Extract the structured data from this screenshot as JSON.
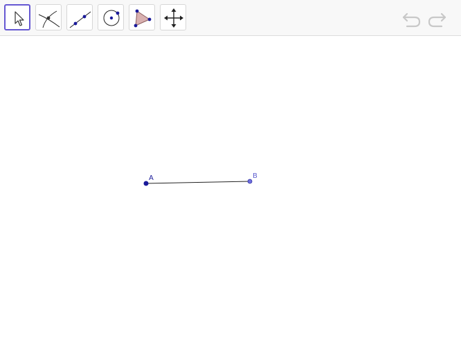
{
  "toolbar": {
    "tools": [
      {
        "name": "move",
        "icon": "cursor-arrow-icon",
        "selected": true
      },
      {
        "name": "intersect",
        "icon": "intersect-icon",
        "selected": false
      },
      {
        "name": "line",
        "icon": "line-through-points-icon",
        "selected": false
      },
      {
        "name": "circle",
        "icon": "circle-center-point-icon",
        "selected": false
      },
      {
        "name": "polygon",
        "icon": "polygon-icon",
        "selected": false
      },
      {
        "name": "move-graphics-view",
        "icon": "move-arrows-icon",
        "selected": false
      }
    ],
    "undo_icon": "undo-icon",
    "redo_icon": "redo-icon"
  },
  "canvas": {
    "points": [
      {
        "label": "A"
      },
      {
        "label": "B"
      }
    ],
    "segment": {
      "from": "A",
      "to": "B"
    }
  },
  "colors": {
    "selected_border": "#6557d2",
    "point_fill": "#5050d0",
    "point_A_fill": "#1a1a9a",
    "label_A": "#1a1a9a",
    "label_B": "#6060d0",
    "polygon_fill": "#d8b0b0"
  }
}
